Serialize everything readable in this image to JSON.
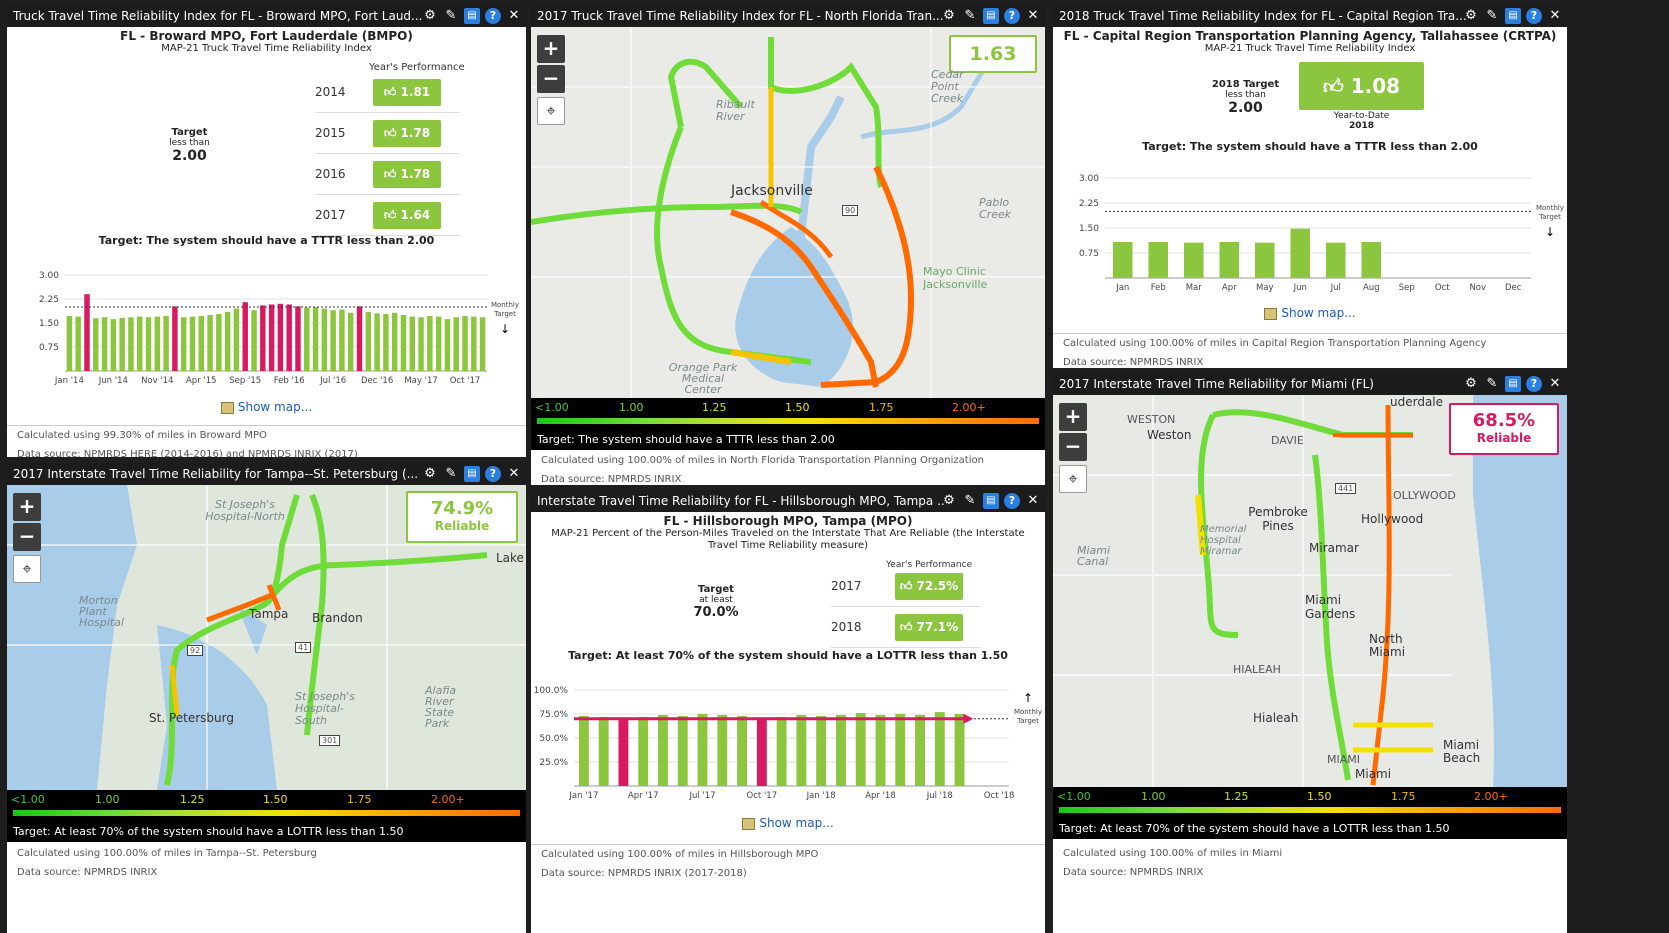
{
  "icons": {
    "settings": "gear-icon",
    "edit": "pencil-icon",
    "save": "save-icon",
    "help": "help-icon",
    "close": "close-icon",
    "zoom_in": "plus-icon",
    "zoom_out": "minus-icon",
    "locate": "locate-icon",
    "thumb": "thumbs-up-icon",
    "map": "map-icon"
  },
  "colors": {
    "good": "#8cc63f",
    "bad": "#d81b60",
    "header": "#1c1c1c",
    "link": "#1a5fb4"
  },
  "p1": {
    "header": "Truck Travel Time Reliability Index for FL - Broward MPO, Fort Laud...",
    "title": "FL - Broward MPO, Fort Lauderdale (BMPO)",
    "subtitle": "MAP-21 Truck Travel Time Reliability Index",
    "perf_label": "Year's Performance",
    "target_label": "Target",
    "target_qual": "less than",
    "target_value": "2.00",
    "years": [
      {
        "year": "2014",
        "value": "1.81"
      },
      {
        "year": "2015",
        "value": "1.78"
      },
      {
        "year": "2016",
        "value": "1.78"
      },
      {
        "year": "2017",
        "value": "1.64"
      }
    ],
    "target_statement": "Target: The system should have a TTTR less than 2.00",
    "monthly_target_label": "Monthly Target",
    "show_map": "Show map...",
    "calc": "Calculated using 99.30% of miles in Broward MPO",
    "source": "Data source: NPMRDS HERE (2014-2016) and NPMRDS INRIX (2017)"
  },
  "p2": {
    "header": "2017 Truck Travel Time Reliability Index for FL - North Florida Tran...",
    "kpi": "1.63",
    "legend": [
      "<1.00",
      "1.00",
      "1.25",
      "1.50",
      "1.75",
      "2.00+"
    ],
    "target_statement": "Target: The system should have a TTTR less than 2.00",
    "labels": {
      "jax": "Jacksonville",
      "ribault": "Ribault River",
      "cedar": "Cedar Point Creek",
      "pablo": "Pablo Creek",
      "mayo": "Mayo Clinic Jacksonville",
      "orange": "Orange Park Medical Center",
      "r90": "90"
    },
    "calc": "Calculated using 100.00% of miles in North Florida Transportation Planning Organization",
    "source": "Data source: NPMRDS INRIX"
  },
  "p3": {
    "header": "2018 Truck Travel Time Reliability Index for FL - Capital Region Tra...",
    "title": "FL - Capital Region Transportation Planning Agency, Tallahassee (CRTPA)",
    "subtitle": "MAP-21 Truck Travel Time Reliability Index",
    "target_label": "2018 Target",
    "target_qual": "less than",
    "target_value": "2.00",
    "kpi": "1.08",
    "ytd": "Year-to-Date",
    "ytd_year": "2018",
    "target_statement": "Target: The system should have a TTTR less than 2.00",
    "monthly_target_label": "Monthly Target",
    "show_map": "Show map...",
    "calc": "Calculated using 100.00% of miles in Capital Region Transportation Planning Agency",
    "source": "Data source: NPMRDS INRIX"
  },
  "p4": {
    "header": "2017 Interstate Travel Time Reliability for Tampa--St. Petersburg (...",
    "kpi": "74.9%",
    "kpi_sub": "Reliable",
    "legend": [
      "<1.00",
      "1.00",
      "1.25",
      "1.50",
      "1.75",
      "2.00+"
    ],
    "target_statement": "Target: At least 70% of the system should have a LOTTR less than 1.50",
    "labels": {
      "tampa": "Tampa",
      "brandon": "Brandon",
      "lake": "Lake",
      "stpete": "St. Petersburg",
      "stjn": "St Joseph's Hospital-North",
      "morton": "Morton Plant Hospital",
      "stjs": "St Joseph's Hospital-South",
      "alafia": "Alafia River State Park",
      "r92": "92",
      "r41": "41",
      "r301": "301"
    },
    "calc": "Calculated using 100.00% of miles in Tampa--St. Petersburg",
    "source": "Data source: NPMRDS INRIX"
  },
  "p5": {
    "header": "Interstate Travel Time Reliability for FL - Hillsborough MPO, Tampa ...",
    "title": "FL - Hillsborough MPO, Tampa (MPO)",
    "subtitle": "MAP-21 Percent of the Person-Miles Traveled on the Interstate That Are Reliable (the Interstate Travel Time Reliability measure)",
    "perf_label": "Year's Performance",
    "target_label": "Target",
    "target_qual": "at least",
    "target_value": "70.0%",
    "years": [
      {
        "year": "2017",
        "value": "72.5%"
      },
      {
        "year": "2018",
        "value": "77.1%"
      }
    ],
    "target_statement": "Target: At least 70% of the system should have a LOTTR less than 1.50",
    "monthly_target_label": "Monthly Target",
    "show_map": "Show map...",
    "calc": "Calculated using 100.00% of miles in Hillsborough MPO",
    "source": "Data source: NPMRDS INRIX (2017-2018)"
  },
  "p6": {
    "header": "2017 Interstate Travel Time Reliability for Miami (FL)",
    "kpi": "68.5%",
    "kpi_sub": "Reliable",
    "legend": [
      "<1.00",
      "1.00",
      "1.25",
      "1.50",
      "1.75",
      "2.00+"
    ],
    "target_statement": "Target: At least 70% of the system should have a LOTTR less than 1.50",
    "labels": {
      "weston": "WESTON",
      "westo": "Weston",
      "davie": "DAVIE",
      "lauderdale": "uderdale",
      "hollywood_c": "OLLYWOOD",
      "hollywood": "Hollywood",
      "pembroke": "Pembroke Pines",
      "miramar": "Miramar",
      "miamicanal": "Miami Canal",
      "memorial": "Memorial Hospital Miramar",
      "gardens": "Miami Gardens",
      "northmiami": "North Miami",
      "hialeah_c": "HIALEAH",
      "hialeah": "Hialeah",
      "miamibeach": "Miami Beach",
      "miami": "Miami",
      "miami_c": "MIAMI",
      "r441": "441"
    },
    "calc": "Calculated using 100.00% of miles in Miami",
    "source": "Data source: NPMRDS INRIX"
  },
  "chart_data": [
    {
      "type": "bar",
      "title": "",
      "categories": [
        "Jan '14",
        "Feb '14",
        "Mar '14",
        "Apr '14",
        "May '14",
        "Jun '14",
        "Jul '14",
        "Aug '14",
        "Sep '14",
        "Oct '14",
        "Nov '14",
        "Dec '14",
        "Jan '15",
        "Feb '15",
        "Mar '15",
        "Apr '15",
        "May '15",
        "Jun '15",
        "Jul '15",
        "Aug '15",
        "Sep '15",
        "Oct '15",
        "Nov '15",
        "Dec '15",
        "Jan '16",
        "Feb '16",
        "Mar '16",
        "Apr '16",
        "May '16",
        "Jun '16",
        "Jul '16",
        "Aug '16",
        "Sep '16",
        "Oct '16",
        "Nov '16",
        "Dec '16",
        "Jan '17",
        "Feb '17",
        "Mar '17",
        "Apr '17",
        "May '17",
        "Jun '17",
        "Jul '17",
        "Aug '17",
        "Sep '17",
        "Oct '17",
        "Nov '17",
        "Dec '17"
      ],
      "tick_labels": [
        "Jan '14",
        "Jun '14",
        "Nov '14",
        "Apr '15",
        "Sep '15",
        "Feb '16",
        "Jul '16",
        "Dec '16",
        "May '17",
        "Oct '17"
      ],
      "values": [
        1.72,
        1.7,
        2.4,
        1.65,
        1.68,
        1.62,
        1.66,
        1.68,
        1.7,
        1.68,
        1.7,
        1.72,
        2.02,
        1.68,
        1.7,
        1.72,
        1.75,
        1.78,
        1.85,
        1.95,
        2.15,
        1.9,
        2.05,
        2.08,
        2.1,
        2.08,
        2.02,
        1.98,
        2.0,
        1.95,
        1.9,
        1.92,
        1.82,
        2.02,
        1.85,
        1.8,
        1.78,
        1.82,
        1.75,
        1.7,
        1.68,
        1.72,
        1.7,
        1.62,
        1.68,
        1.72,
        1.7,
        1.68
      ],
      "ylim": [
        0,
        3.0
      ],
      "yticks": [
        "0.75",
        "1.50",
        "2.25",
        "3.00"
      ],
      "target": 2.0,
      "threshold": 2.0
    },
    {
      "type": "bar",
      "title": "",
      "categories": [
        "Jan",
        "Feb",
        "Mar",
        "Apr",
        "May",
        "Jun",
        "Jul",
        "Aug",
        "Sep",
        "Oct",
        "Nov",
        "Dec"
      ],
      "values": [
        1.08,
        1.08,
        1.06,
        1.08,
        1.06,
        1.48,
        1.06,
        1.08,
        null,
        null,
        null,
        null
      ],
      "ylim": [
        0,
        3.0
      ],
      "yticks": [
        "0.75",
        "1.50",
        "2.25",
        "3.00"
      ],
      "target": 2.0,
      "threshold": 99
    },
    {
      "type": "bar",
      "title": "",
      "categories": [
        "Jan '17",
        "Feb '17",
        "Mar '17",
        "Apr '17",
        "May '17",
        "Jun '17",
        "Jul '17",
        "Aug '17",
        "Sep '17",
        "Oct '17",
        "Nov '17",
        "Dec '17",
        "Jan '18",
        "Feb '18",
        "Mar '18",
        "Apr '18",
        "May '18",
        "Jun '18",
        "Jul '18",
        "Aug '18",
        "Sep '18",
        "Oct '18"
      ],
      "tick_labels": [
        "Jan '17",
        "Apr '17",
        "Jul '17",
        "Oct '17",
        "Jan '18",
        "Apr '18",
        "Jul '18",
        "Oct '18"
      ],
      "values": [
        73,
        72,
        71,
        72,
        74,
        73,
        75,
        74,
        73,
        71,
        72,
        74,
        73,
        74,
        76,
        74,
        75,
        74,
        77,
        75,
        null,
        null
      ],
      "bad_index": [
        2,
        9
      ],
      "ylim": [
        0,
        100
      ],
      "yticks": [
        "25.0%",
        "50.0%",
        "75.0%",
        "100.0%"
      ],
      "target": 70
    }
  ]
}
